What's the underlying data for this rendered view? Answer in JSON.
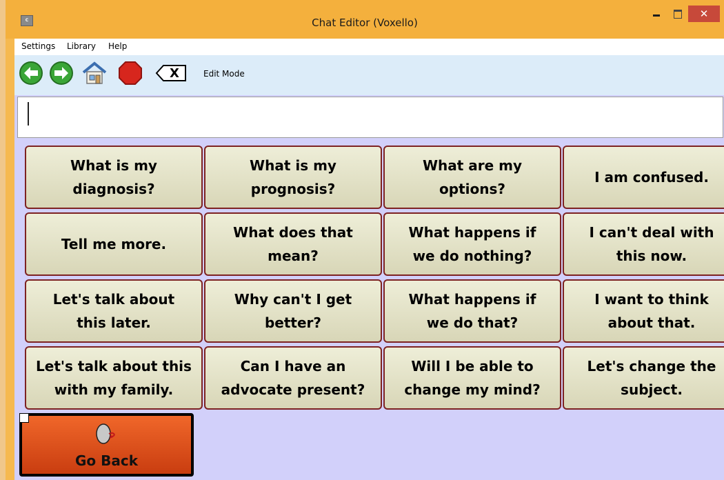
{
  "window": {
    "title": "Chat Editor (Voxello)",
    "close_glyph": "✕"
  },
  "menu": {
    "items": [
      "Settings",
      "Library",
      "Help"
    ]
  },
  "toolbar": {
    "icons": [
      "back-arrow-icon",
      "forward-arrow-icon",
      "home-icon",
      "stop-icon",
      "clear-text-icon"
    ],
    "clear_glyph": "X",
    "mode_label": "Edit Mode"
  },
  "message_box": {
    "value": ""
  },
  "phrases": [
    [
      "What is my\ndiagnosis?",
      "What is my\nprognosis?",
      "What are my\noptions?",
      "I am confused."
    ],
    [
      "Tell me more.",
      "What does that\nmean?",
      "What happens if\nwe do nothing?",
      "I can't deal with\nthis now."
    ],
    [
      "Let's talk about\nthis later.",
      "Why can't I get\nbetter?",
      "What happens if\nwe do that?",
      "I want to think\nabout that."
    ],
    [
      "Let's talk about this\nwith my family.",
      "Can I have an\nadvocate present?",
      "Will I be able to\nchange my mind?",
      "Let's change the\nsubject."
    ]
  ],
  "go_back": {
    "label": "Go Back",
    "icon": "go-back-icon"
  },
  "colors": {
    "phrase_border": "#7d2222",
    "go_back_bg": "#e4531d",
    "grid_bg": "#d2d0fa",
    "title_bar": "#f4b03d"
  }
}
